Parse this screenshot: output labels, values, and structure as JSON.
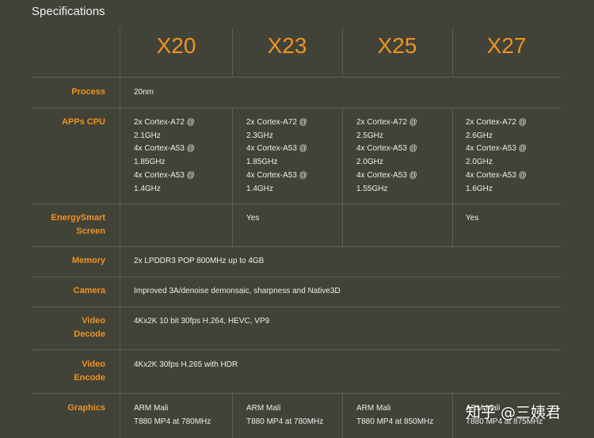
{
  "title": "Specifications",
  "models": [
    "X20",
    "X23",
    "X25",
    "X27"
  ],
  "rows": {
    "process": {
      "label": [
        "Process"
      ],
      "value": "20nm"
    },
    "apps_cpu": {
      "label": [
        "APPs CPU"
      ],
      "cells": [
        [
          "2x Cortex-A72 @",
          "2.1GHz",
          "4x Cortex-A53 @",
          "1.85GHz",
          "4x Cortex-A53 @",
          "1.4GHz"
        ],
        [
          "2x Cortex-A72 @",
          "2.3GHz",
          "4x Cortex-A53 @",
          "1.85GHz",
          "4x Cortex-A53 @",
          "1.4GHz"
        ],
        [
          "2x Cortex-A72 @",
          "2.5GHz",
          "4x Cortex-A53 @",
          "2.0GHz",
          "4x Cortex-A53 @",
          "1.55GHz"
        ],
        [
          "2x Cortex-A72 @",
          "2.6GHz",
          "4x Cortex-A53 @",
          "2.0GHz",
          "4x Cortex-A53 @",
          "1.6GHz"
        ]
      ]
    },
    "energysmart": {
      "label": [
        "EnergySmart",
        "Screen"
      ],
      "cells": [
        "",
        "Yes",
        "",
        "Yes"
      ]
    },
    "memory": {
      "label": [
        "Memory"
      ],
      "value": "2x LPDDR3 POP 800MHz up to 4GB"
    },
    "camera": {
      "label": [
        "Camera"
      ],
      "value": "Improved 3A/denoise demonsaic, sharpness and Native3D"
    },
    "video_decode": {
      "label": [
        "Video",
        "Decode"
      ],
      "value": "4Kx2K 10 bit 30fps H.264, HEVC, VP9"
    },
    "video_encode": {
      "label": [
        "Video",
        "Encode"
      ],
      "value": "4Kx2K 30fps H.265 with HDR"
    },
    "graphics": {
      "label": [
        "Graphics"
      ],
      "cells": [
        [
          "ARM Mali",
          "T880 MP4 at 780MHz"
        ],
        [
          "ARM Mali",
          "T880 MP4 at 780MHz"
        ],
        [
          "ARM Mali",
          "T880 MP4 at 850MHz"
        ],
        [
          "ARM Mali",
          "T880 MP4 at 875MHz"
        ]
      ]
    }
  },
  "watermark": "知乎 @三姨君"
}
